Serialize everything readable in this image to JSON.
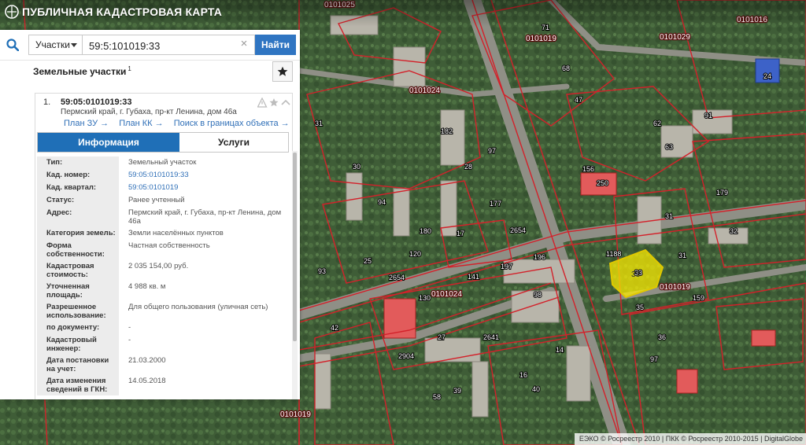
{
  "app": {
    "title": "ПУБЛИЧНАЯ КАДАСТРОВАЯ КАРТА"
  },
  "search": {
    "type_label": "Участки",
    "query": "59:5:101019:33",
    "button_label": "Найти"
  },
  "results": {
    "heading": "Земельные участки",
    "count": "1"
  },
  "result": {
    "index": "1.",
    "cadastral_number": "59:05:0101019:33",
    "address": "Пермский край, г. Губаха, пр-кт Ленина, дом 46а",
    "links": [
      "План ЗУ →",
      "План КК →",
      "Поиск в границах объекта →"
    ]
  },
  "tabs": {
    "info": "Информация",
    "services": "Услуги"
  },
  "info_rows": [
    {
      "key": "Тип:",
      "value": "Земельный участок"
    },
    {
      "key": "Кад. номер:",
      "value": "59:05:0101019:33"
    },
    {
      "key": "Кад. квартал:",
      "value": "59:05:0101019"
    },
    {
      "key": "Статус:",
      "value": "Ранее учтенный"
    },
    {
      "key": "Адрес:",
      "value": "Пермский край, г. Губаха, пр-кт Ленина, дом 46а"
    },
    {
      "key": "Категория земель:",
      "value": "Земли населённых пунктов"
    },
    {
      "key": "Форма собственности:",
      "value": "Частная собственность"
    },
    {
      "key": "Кадастровая стоимость:",
      "value": "2 035 154,00 руб."
    },
    {
      "key": "Уточненная площадь:",
      "value": "4 988 кв. м"
    },
    {
      "key": "Разрешенное использование:",
      "value": "Для общего пользования (уличная сеть)"
    },
    {
      "key": "по документу:",
      "value": "-"
    },
    {
      "key": "Кадастровый инженер:",
      "value": "-"
    },
    {
      "key": "Дата постановки на учет:",
      "value": "21.03.2000"
    },
    {
      "key": "Дата изменения сведений в ГКН:",
      "value": "14.05.2018"
    }
  ],
  "map": {
    "quarter_labels": [
      "0101025",
      "0101019",
      "0101029",
      "0101016",
      "0101024",
      "0101019",
      "0101024",
      "0101019"
    ],
    "parcel_labels": [
      "71",
      "68",
      "47",
      "62",
      "63",
      "91",
      "24",
      "31",
      "28",
      "182",
      "97",
      "30",
      "94",
      "177",
      "156",
      "250",
      "179",
      "31",
      "32",
      "180",
      "17",
      "2654",
      "25",
      "120",
      "1188",
      "33",
      "31",
      "197",
      "196",
      "93",
      "2654",
      "141",
      "98",
      "130",
      "35",
      "36",
      "159",
      "42",
      "27",
      "14",
      "97",
      "16",
      "2641",
      "2904",
      "58",
      "39",
      "40"
    ],
    "highlighted_parcel": "33"
  },
  "attribution": "ЕЭКО © Росреестр 2010 | ПКК © Росреестр 2010-2015 | DigitalGlobe"
}
